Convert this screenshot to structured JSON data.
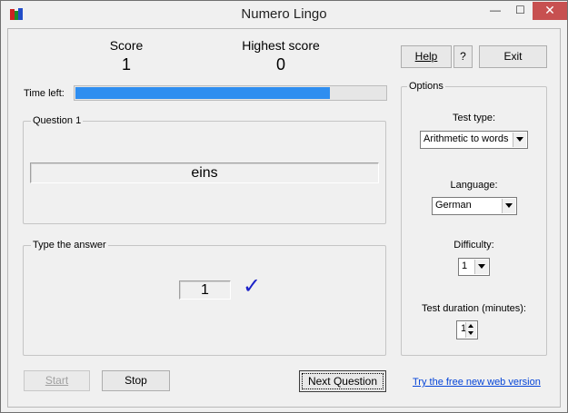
{
  "window": {
    "title": "Numero Lingo",
    "minimize_glyph": "—",
    "maximize_glyph": "☐",
    "close_glyph": "✕"
  },
  "scores": {
    "score_label": "Score",
    "score_value": "1",
    "highest_label": "Highest score",
    "highest_value": "0"
  },
  "timer": {
    "label": "Time left:",
    "progress_fraction": 0.82
  },
  "question": {
    "group_title": "Question 1",
    "text": "eins"
  },
  "answer": {
    "group_title": "Type the answer",
    "value": "1",
    "check_glyph": "✓"
  },
  "buttons": {
    "help": "Help",
    "question_mark": "?",
    "exit": "Exit",
    "start": "Start",
    "stop": "Stop",
    "next": "Next Question"
  },
  "options": {
    "group_title": "Options",
    "test_type_label": "Test type:",
    "test_type_value": "Arithmetic to words",
    "language_label": "Language:",
    "language_value": "German",
    "difficulty_label": "Difficulty:",
    "difficulty_value": "1",
    "duration_label": "Test duration (minutes):",
    "duration_value": "1"
  },
  "link": {
    "text": "Try the free new web version"
  },
  "colors": {
    "progress": "#2f8ef0",
    "check": "#1c22c8",
    "link": "#0645d8",
    "close_button": "#c75050"
  },
  "icons": [
    "app-icon",
    "minimize-icon",
    "maximize-icon",
    "close-icon",
    "checkmark-icon",
    "dropdown-arrow-icon",
    "spin-up-icon",
    "spin-down-icon"
  ]
}
